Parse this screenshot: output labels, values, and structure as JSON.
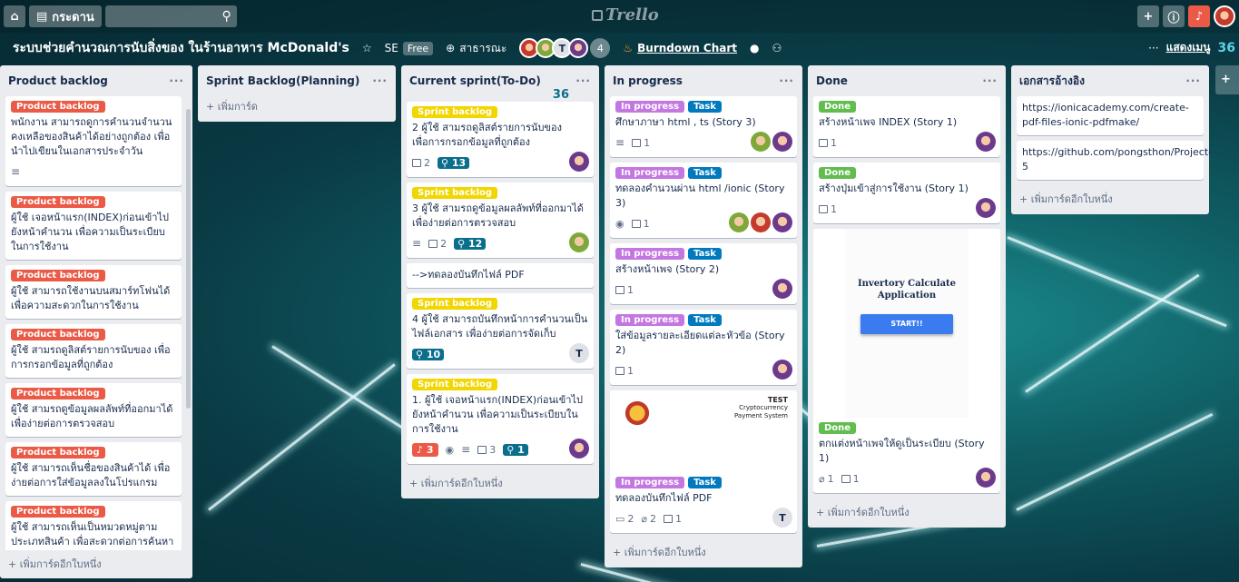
{
  "topbar": {
    "home_icon": "home-icon",
    "boards_label": "กระดาน",
    "search_icon": "search-icon",
    "logo_text": "Trello",
    "right_icons": [
      "plus-icon",
      "info-icon",
      "bell-icon",
      "avatar"
    ]
  },
  "board": {
    "title": "ระบบช่วยคำนวณการนับสิ่งของ ในร้านอาหาร McDonald's",
    "team": "SE",
    "plan": "Free",
    "visibility": "สาธารณะ",
    "member_count": "4",
    "member_initial": "T",
    "burndown": "Burndown Chart",
    "show_menu": "แสดงเมนู",
    "points_total": "36"
  },
  "lists": [
    {
      "title": "Product backlog",
      "cards": [
        {
          "labels": [
            {
              "text": "Product backlog",
              "color": "red"
            }
          ],
          "title": "พนักงาน สามารถดูการคำนวนจำนวนคงเหลือของสินค้าได้อย่างถูกต้อง เพื่อนำไปเขียนในเอกสารประจำวัน",
          "desc": true
        },
        {
          "labels": [
            {
              "text": "Product backlog",
              "color": "red"
            }
          ],
          "title": "ผู้ใช้ เจอหน้าแรก(INDEX)ก่อนเข้าไปยังหน้าคำนวน เพื่อความเป็นระเบียบในการใช้งาน"
        },
        {
          "labels": [
            {
              "text": "Product backlog",
              "color": "red"
            }
          ],
          "title": "ผู้ใช้ สามารถใช้งานบนสมาร์ทโฟนได้ เพื่อความสะดวกในการใช้งาน"
        },
        {
          "labels": [
            {
              "text": "Product backlog",
              "color": "red"
            }
          ],
          "title": "ผู้ใช้ สามรถดูลิสต์รายการนับของ เพื่อการกรอกข้อมูลที่ถูกต้อง"
        },
        {
          "labels": [
            {
              "text": "Product backlog",
              "color": "red"
            }
          ],
          "title": "ผู้ใช้ สามรถดูข้อมูลผลลัพท์ที่ออกมาได้ เพื่อง่ายต่อการตรวจสอบ"
        },
        {
          "labels": [
            {
              "text": "Product backlog",
              "color": "red"
            }
          ],
          "title": "ผู้ใช้ สามารถเห็นชื่อของสินค้าได้ เพื่อง่ายต่อการใส่ข้อมูลลงในโปรแกรม"
        },
        {
          "labels": [
            {
              "text": "Product backlog",
              "color": "red"
            }
          ],
          "title": "ผู้ใช้ สามารถเห็นเป็นหมวดหมู่ตามประเภทสินค้า เพื่อสะดวกต่อการค้นหา"
        }
      ],
      "add_label": "เพิ่มการ์ดอีกใบหนึ่ง"
    },
    {
      "title": "Sprint Backlog(Planning)",
      "cards": [],
      "add_label": "เพิ่มการ์ด"
    },
    {
      "title": "Current sprint(To-Do)",
      "points": "36",
      "cards": [
        {
          "labels": [
            {
              "text": "Sprint backlog",
              "color": "yellow"
            }
          ],
          "title": "2 ผู้ใช้ สามรถดูลิสต์รายการนับของ เพื่อการกรอกข้อมูลที่ถูกต้อง",
          "checklist": "2",
          "points": "13",
          "avatars": [
            "purple"
          ]
        },
        {
          "labels": [
            {
              "text": "Sprint backlog",
              "color": "yellow"
            }
          ],
          "title": "3 ผู้ใช้ สามรถดูข้อมูลผลลัพท์ที่ออกมาได้ เพื่อง่ายต่อการตรวจสอบ",
          "desc": true,
          "checklist": "2",
          "points": "12",
          "avatars": [
            "green"
          ]
        },
        {
          "labels": [],
          "title": "-->ทดลองบันทึกไฟล์ PDF"
        },
        {
          "labels": [
            {
              "text": "Sprint backlog",
              "color": "yellow"
            }
          ],
          "title": "4 ผู้ใช้ สามารถบันทึกหน้าการคำนวนเป็นไฟล์เอกสาร เพื่อง่ายต่อการจัดเก็บ",
          "points": "10",
          "avatars": [
            "t"
          ]
        },
        {
          "labels": [
            {
              "text": "Sprint backlog",
              "color": "yellow"
            }
          ],
          "title": "1. ผู้ใช้ เจอหน้าแรก(INDEX)ก่อนเข้าไปยังหน้าคำนวน เพื่อความเป็นระเบียบในการใช้งาน",
          "alert": "3",
          "watch": true,
          "desc": true,
          "checklist": "3",
          "points": "1",
          "avatars": [
            "purple"
          ]
        }
      ],
      "add_label": "เพิ่มการ์ดอีกใบหนึ่ง"
    },
    {
      "title": "In progress",
      "cards": [
        {
          "labels": [
            {
              "text": "In progress",
              "color": "purple"
            },
            {
              "text": "Task",
              "color": "blue"
            }
          ],
          "title": "ศึกษาภาษา html , ts (Story 3)",
          "desc": true,
          "checklist": "1",
          "avatars": [
            "green",
            "purple"
          ]
        },
        {
          "labels": [
            {
              "text": "In progress",
              "color": "purple"
            },
            {
              "text": "Task",
              "color": "blue"
            }
          ],
          "title": "ทดลองคำนวนผ่าน html /ionic (Story 3)",
          "watch": true,
          "checklist": "1",
          "avatars": [
            "green",
            "red",
            "purple"
          ]
        },
        {
          "labels": [
            {
              "text": "In progress",
              "color": "purple"
            },
            {
              "text": "Task",
              "color": "blue"
            }
          ],
          "title": "สร้างหน้าเพจ (Story 2)",
          "checklist": "1",
          "avatars": [
            "purple"
          ]
        },
        {
          "labels": [
            {
              "text": "In progress",
              "color": "purple"
            },
            {
              "text": "Task",
              "color": "blue"
            }
          ],
          "title": "ใส่ข้อมูลรายละเอียดแต่ละหัวข้อ (Story 2)",
          "checklist": "1",
          "avatars": [
            "purple"
          ]
        },
        {
          "cover": {
            "heading": "TEST",
            "subheading": "Cryptocurrency Payment System"
          },
          "labels": [
            {
              "text": "In progress",
              "color": "purple"
            },
            {
              "text": "Task",
              "color": "blue"
            }
          ],
          "title": "ทดลองบันทึกไฟล์ PDF",
          "comments": "2",
          "attachments": "2",
          "checklist": "1",
          "avatars": [
            "t"
          ]
        }
      ],
      "add_label": "เพิ่มการ์ดอีกใบหนึ่ง"
    },
    {
      "title": "Done",
      "cards": [
        {
          "labels": [
            {
              "text": "Done",
              "color": "green"
            }
          ],
          "title": "สร้างหน้าเพจ INDEX (Story 1)",
          "checklist": "1",
          "avatars": [
            "purple"
          ]
        },
        {
          "labels": [
            {
              "text": "Done",
              "color": "green"
            }
          ],
          "title": "สร้างปุ่มเข้าสู่การใช้งาน (Story 1)",
          "checklist": "1",
          "avatars": [
            "purple"
          ]
        },
        {
          "cover": {
            "heading": "Invertory Calculate Application",
            "button": "START!!"
          },
          "labels": [
            {
              "text": "Done",
              "color": "green"
            }
          ],
          "title": "ตกแต่งหน้าเพจให้ดูเป็นระเบียบ (Story 1)",
          "attachments": "1",
          "checklist": "1",
          "avatars": [
            "purple"
          ]
        }
      ],
      "add_label": "เพิ่มการ์ดอีกใบหนึ่ง"
    },
    {
      "title": "เอกสารอ้างอิง",
      "cards": [
        {
          "labels": [],
          "title": "https://ionicacademy.com/create-pdf-files-ionic-pdfmake/"
        },
        {
          "labels": [],
          "title": "https://github.com/pongsthon/Project-5"
        }
      ],
      "add_label": "เพิ่มการ์ดอีกใบหนึ่ง"
    }
  ],
  "colors": {
    "red": "#eb5a46",
    "yellow": "#f2d600",
    "purple": "#c377e0",
    "blue": "#0079bf",
    "green": "#61bd4f",
    "points": "#0a6e8c"
  }
}
